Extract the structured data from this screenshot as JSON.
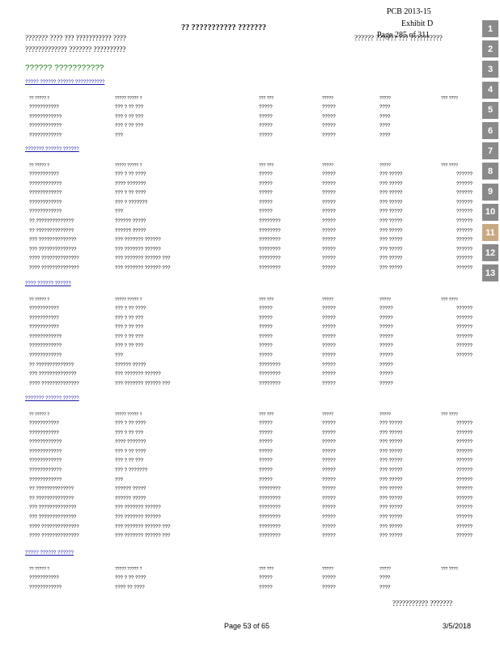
{
  "exhibit": {
    "line1": "PCB  2013-15",
    "line2": "Exhibit  D",
    "line3": "Page  285  of  311"
  },
  "title": "?? ??????????? ???????",
  "header_left_1": "??????? ???? ??? ??????????? ????",
  "header_left_2": "????????????? ??????? ??????????",
  "header_right": "?????? ??? ??? ??? ??????????",
  "green_heading": "?????? ???????????",
  "col_headers": [
    "?? ????? ?",
    "????? ????? ?",
    "??? ???",
    "?????",
    "?????",
    "??? ????"
  ],
  "sections": [
    {
      "title": "????? ?????? ?????? ???????????",
      "rows": [
        [
          "???????????",
          "??? ? ?? ???",
          "?????",
          "?????",
          "????",
          ""
        ],
        [
          "????????????",
          "??? ? ?? ???",
          "?????",
          "?????",
          "????",
          ""
        ],
        [
          "????????????",
          "??? ? ?? ???",
          "?????",
          "?????",
          "????",
          ""
        ],
        [
          "????????????",
          "???",
          "?????",
          "?????",
          "????",
          ""
        ]
      ]
    },
    {
      "title": "??????? ?????? ??????",
      "rows": [
        [
          "???????????",
          "??? ? ?? ????",
          "?????",
          "?????",
          "??? ?????",
          "??????"
        ],
        [
          "????????????",
          "???? ???????",
          "?????",
          "?????",
          "??? ?????",
          "??????"
        ],
        [
          "????????????",
          "??? ? ?? ????",
          "?????",
          "?????",
          "??? ?????",
          "??????"
        ],
        [
          "????????????",
          "??? ? ???????",
          "?????",
          "?????",
          "??? ?????",
          "??????"
        ],
        [
          "????????????",
          "???",
          "?????",
          "?????",
          "??? ?????",
          "??????"
        ],
        [
          "?? ??????????????",
          "?????? ?????",
          "????????",
          "?????",
          "??? ?????",
          "??????"
        ],
        [
          "?? ??????????????",
          "?????? ?????",
          "????????",
          "?????",
          "??? ?????",
          "??????"
        ],
        [
          "??? ??????????????",
          "??? ??????? ??????",
          "????????",
          "?????",
          "??? ?????",
          "??????"
        ],
        [
          "??? ??????????????",
          "??? ??????? ??????",
          "????????",
          "?????",
          "??? ?????",
          "??????"
        ],
        [
          "???? ??????????????",
          "??? ??????? ?????? ???",
          "????????",
          "?????",
          "??? ?????",
          "??????"
        ],
        [
          "???? ??????????????",
          "??? ??????? ?????? ???",
          "????????",
          "?????",
          "??? ?????",
          "??????"
        ]
      ]
    },
    {
      "title": "???? ?????? ??????",
      "rows": [
        [
          "???????????",
          "??? ? ?? ????",
          "?????",
          "?????",
          "?????",
          "??????"
        ],
        [
          "???????????",
          "??? ? ?? ???",
          "?????",
          "?????",
          "?????",
          "??????"
        ],
        [
          "???????????",
          "??? ? ?? ???",
          "?????",
          "?????",
          "?????",
          "??????"
        ],
        [
          "????????????",
          "??? ? ?? ???",
          "?????",
          "?????",
          "?????",
          "??????"
        ],
        [
          "????????????",
          "??? ? ?? ???",
          "?????",
          "?????",
          "?????",
          "??????"
        ],
        [
          "????????????",
          "???",
          "?????",
          "?????",
          "?????",
          "??????"
        ],
        [
          "?? ??????????????",
          "?????? ?????",
          "????????",
          "?????",
          "?????",
          ""
        ],
        [
          "??? ??????????????",
          "??? ??????? ??????",
          "????????",
          "?????",
          "?????",
          ""
        ],
        [
          "???? ??????????????",
          "??? ??????? ?????? ???",
          "????????",
          "?????",
          "?????",
          ""
        ]
      ]
    },
    {
      "title": "??????? ?????? ??????",
      "rows": [
        [
          "???????????",
          "??? ? ?? ????",
          "?????",
          "?????",
          "??? ?????",
          "??????"
        ],
        [
          "???????????",
          "??? ? ?? ???",
          "?????",
          "?????",
          "??? ?????",
          "??????"
        ],
        [
          "????????????",
          "???? ???????",
          "?????",
          "?????",
          "??? ?????",
          "??????"
        ],
        [
          "????????????",
          "??? ? ?? ????",
          "?????",
          "?????",
          "??? ?????",
          "??????"
        ],
        [
          "????????????",
          "??? ? ?? ???",
          "?????",
          "?????",
          "??? ?????",
          "??????"
        ],
        [
          "????????????",
          "??? ? ???????",
          "?????",
          "?????",
          "??? ?????",
          "??????"
        ],
        [
          "????????????",
          "???",
          "?????",
          "?????",
          "??? ?????",
          "??????"
        ],
        [
          "?? ??????????????",
          "?????? ?????",
          "????????",
          "?????",
          "??? ?????",
          "??????"
        ],
        [
          "?? ??????????????",
          "?????? ?????",
          "????????",
          "?????",
          "??? ?????",
          "??????"
        ],
        [
          "??? ??????????????",
          "??? ??????? ??????",
          "????????",
          "?????",
          "??? ?????",
          "??????"
        ],
        [
          "??? ??????????????",
          "??? ??????? ??????",
          "????????",
          "?????",
          "??? ?????",
          "??????"
        ],
        [
          "???? ??????????????",
          "??? ??????? ?????? ???",
          "????????",
          "?????",
          "??? ?????",
          "??????"
        ],
        [
          "???? ??????????????",
          "??? ??????? ?????? ???",
          "????????",
          "?????",
          "??? ?????",
          "??????"
        ]
      ]
    },
    {
      "title": "????? ?????? ??????",
      "rows": [
        [
          "???????????",
          "??? ? ?? ????",
          "?????",
          "?????",
          "????",
          ""
        ],
        [
          "????????????",
          "???? ?? ????",
          "?????",
          "?????",
          "????",
          ""
        ]
      ]
    }
  ],
  "bottom_right_text": "??????????? ???????",
  "footer_page": "Page 53 of 65",
  "footer_date": "3/5/2018",
  "tabs": [
    "1",
    "2",
    "3",
    "4",
    "5",
    "6",
    "7",
    "8",
    "9",
    "10",
    "11",
    "12",
    "13"
  ],
  "active_tab": "11"
}
